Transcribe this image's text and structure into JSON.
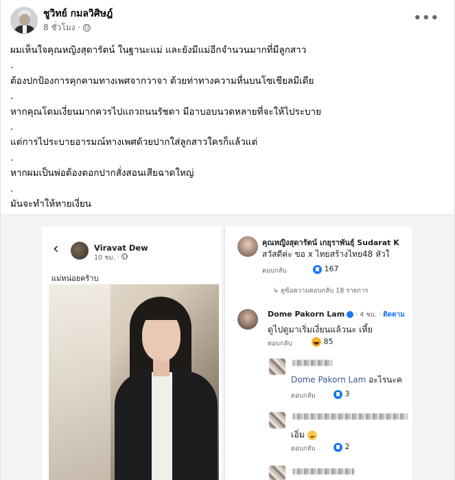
{
  "post": {
    "author": "ชูวิทย์ กมลวิศิษฎ์",
    "time": "8 ชั่วโมง",
    "more": "•••",
    "lines": [
      "ผมเห็นใจคุณหญิงสุดารัตน์ ในฐานะแม่ และยังมีแม่อีกจำนวนมากที่มีลูกสาว",
      ".",
      "ต้องปกป้องการคุกคามทางเพศจากวาจา ด้วยท่าทางความหื่นบนโซเชียลมีเดีย",
      ".",
      "หากคุณโดมเงี่ยนมากควรไปแถวถนนรัชดา มีอาบอบนวดหลายที่จะให้ไประบาย",
      ".",
      "แต่การไประบายอารมณ์ทางเพศด้วยปากใส่ลูกสาวใครก็แล้วแต่",
      ".",
      "หากผมเป็นพ่อต้องตอกปากสั่งสอนเสียฉาดใหญ่",
      ".",
      "มันจะทำให้หายเงี่ยน"
    ]
  },
  "left_shot": {
    "back": "‹",
    "name": "Viravat Dew",
    "time": "10 ชม. · ",
    "caption": "แม่หน่อยคร้าบ"
  },
  "right_shot": {
    "c1": {
      "name": "คุณหญิงสุดารัตน์ เกยุราพันธุ์ Sudarat K",
      "text": "สวัสดีค่ะ ขอ x ไทยสร้างไทย48 หัวใ",
      "reply": "ตอบกลับ",
      "count": "167"
    },
    "more_replies": "↳ ดูข้อความตอบกลับ 18 รายการ",
    "c2": {
      "name": "Dome Pakorn Lam",
      "meta": " · 4 ชม. · ",
      "follow": "ติดตาม",
      "text": "ดูไปดูมาเริ่มเงี่ยนแล้วนะ  เหี้ย",
      "reply": "ตอบกลับ",
      "count": "85"
    },
    "r1": {
      "mention": "Dome Pakorn Lam",
      "text": " อะไรนะค",
      "reply": "ตอบกลับ",
      "count": "3"
    },
    "r2": {
      "text": "เอิ่ม ",
      "reply": "ตอบกลับ",
      "count": "2"
    }
  },
  "colors": {
    "accent": "#1877f2",
    "text": "#050505",
    "muted": "#65676b"
  }
}
